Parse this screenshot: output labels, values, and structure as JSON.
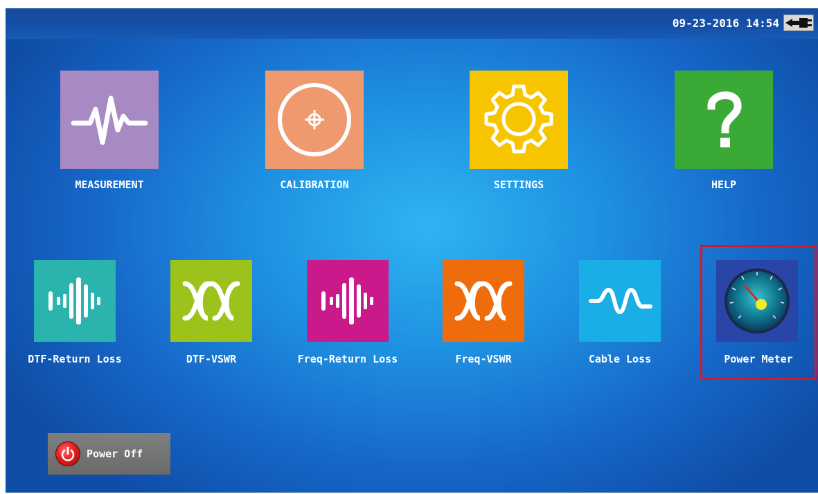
{
  "status_bar": {
    "datetime": "09-23-2016 14:54",
    "power_icon": "ac-plug-icon"
  },
  "main_apps": [
    {
      "label": "MEASUREMENT",
      "icon": "waveform-icon",
      "color": "#a789c4"
    },
    {
      "label": "CALIBRATION",
      "icon": "crosshair-icon",
      "color": "#ef9a6e"
    },
    {
      "label": "SETTINGS",
      "icon": "gear-icon",
      "color": "#f7c500"
    },
    {
      "label": "HELP",
      "icon": "question-icon",
      "color": "#3aa935"
    }
  ],
  "tools": [
    {
      "label": "DTF-Return Loss",
      "icon": "bars-pulse-icon",
      "color": "#2bb3ad"
    },
    {
      "label": "DTF-VSWR",
      "icon": "wave-loops-icon",
      "color": "#9cc31c"
    },
    {
      "label": "Freq-Return Loss",
      "icon": "bars-pulse-icon",
      "color": "#c9198b"
    },
    {
      "label": "Freq-VSWR",
      "icon": "wave-loops-icon",
      "color": "#ee6c0c"
    },
    {
      "label": "Cable Loss",
      "icon": "sine-wave-icon",
      "color": "#19aee6"
    },
    {
      "label": "Power Meter",
      "icon": "gauge-icon",
      "color": "#2a45a8"
    }
  ],
  "power_off": {
    "label": "Power Off",
    "icon": "power-icon"
  },
  "selection": {
    "highlighted": "Power Meter",
    "color": "#d11a2a"
  }
}
